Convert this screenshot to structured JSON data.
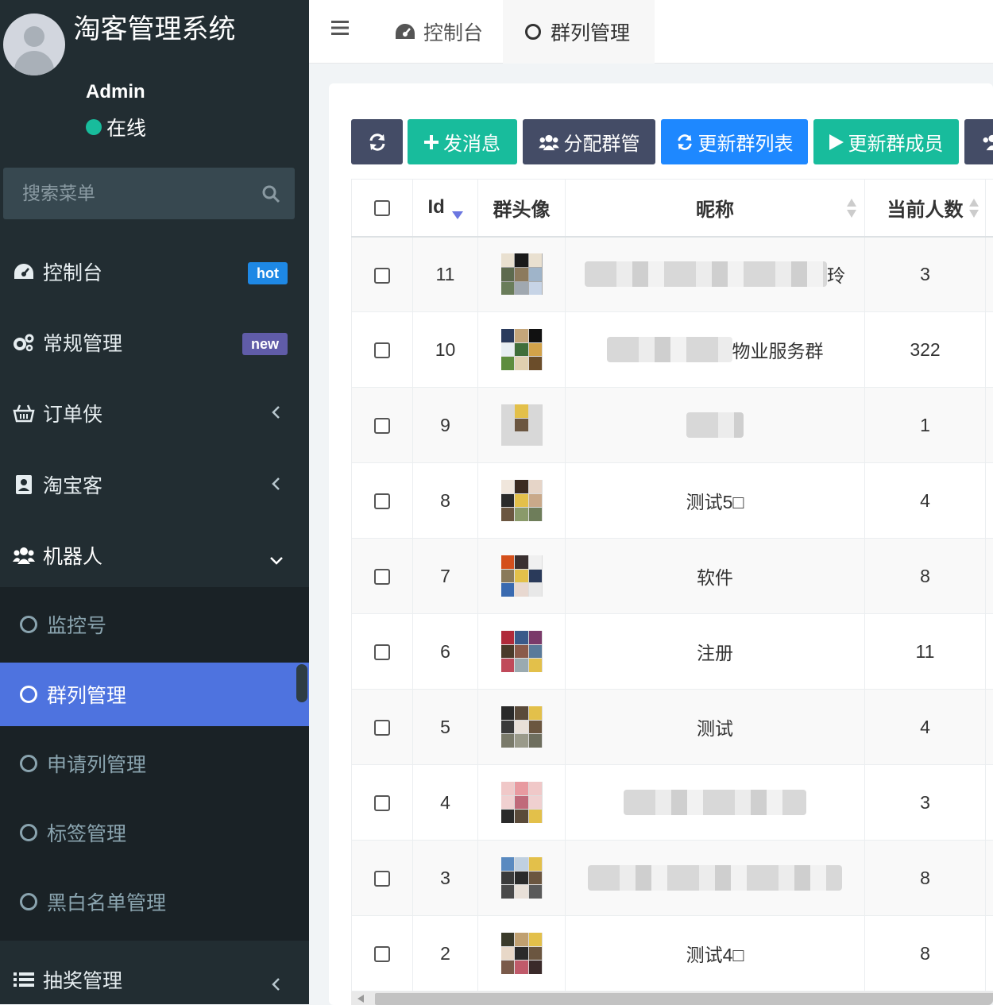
{
  "brand": {
    "title": "淘客管理系统"
  },
  "user": {
    "name": "Admin",
    "status": "在线"
  },
  "search": {
    "placeholder": "搜索菜单"
  },
  "sidebar": {
    "items": [
      {
        "label": "控制台",
        "badge": "hot",
        "badge_color": "#1e88e5"
      },
      {
        "label": "常规管理",
        "badge": "new",
        "badge_color": "#605ca8"
      },
      {
        "label": "订单侠"
      },
      {
        "label": "淘宝客"
      },
      {
        "label": "机器人"
      },
      {
        "label": "抽奖管理"
      }
    ],
    "sub_items": [
      {
        "label": "监控号"
      },
      {
        "label": "群列管理"
      },
      {
        "label": "申请列管理"
      },
      {
        "label": "标签管理"
      },
      {
        "label": "黑白名单管理"
      }
    ]
  },
  "topbar": {
    "tabs": [
      {
        "label": "控制台"
      },
      {
        "label": "群列管理"
      }
    ]
  },
  "toolbar": {
    "buttons": [
      {
        "label": "发消息",
        "color": "#18bc9c"
      },
      {
        "label": "分配群管",
        "color": "#444c66"
      },
      {
        "label": "更新群列表",
        "color": "#1e88ff"
      },
      {
        "label": "更新群成员",
        "color": "#18bc9c"
      }
    ]
  },
  "table": {
    "columns": [
      "Id",
      "群头像",
      "昵称",
      "当前人数"
    ],
    "rows": [
      {
        "id": "11",
        "nickname": "",
        "nickname_tail": "玲",
        "count": "3"
      },
      {
        "id": "10",
        "nickname": "",
        "nickname_tail": "物业服务群",
        "count": "322"
      },
      {
        "id": "9",
        "nickname": "",
        "nickname_tail": "",
        "count": "1"
      },
      {
        "id": "8",
        "nickname": "测试5□",
        "count": "4"
      },
      {
        "id": "7",
        "nickname": "软件",
        "count": "8"
      },
      {
        "id": "6",
        "nickname": "注册",
        "count": "11"
      },
      {
        "id": "5",
        "nickname": "测试",
        "count": "4"
      },
      {
        "id": "4",
        "nickname": "",
        "nickname_tail": "",
        "count": "3"
      },
      {
        "id": "3",
        "nickname": "",
        "nickname_tail": "",
        "count": "8"
      },
      {
        "id": "2",
        "nickname": "测试4□",
        "count": "8"
      }
    ]
  },
  "colors": {
    "accent": "#4e73df",
    "sidebar_bg": "#222d32",
    "online": "#18bc9c"
  }
}
